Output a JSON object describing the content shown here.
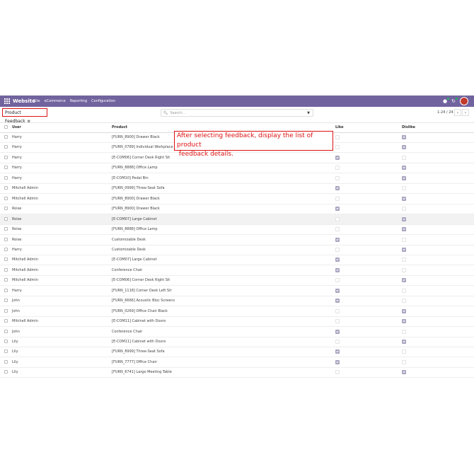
{
  "navbar": {
    "brand": "Website",
    "menu": [
      "Site",
      "eCommerce",
      "Reporting",
      "Configuration"
    ]
  },
  "control_panel": {
    "breadcrumb": "Product Feedback",
    "search_placeholder": "Search...",
    "pager": "1-24 / 24"
  },
  "table": {
    "headers": {
      "user": "User",
      "product": "Product",
      "like": "Like",
      "dislike": "Dislike"
    },
    "rows": [
      {
        "user": "Harry",
        "product": "[FURN_8900] Drawer Black",
        "like": false,
        "dislike": true
      },
      {
        "user": "Harry",
        "product": "[FURN_0789] Individual Workplace",
        "like": false,
        "dislike": true
      },
      {
        "user": "Harry",
        "product": "[E-COM06] Corner Desk Right Sit",
        "like": true,
        "dislike": false
      },
      {
        "user": "Harry",
        "product": "[FURN_8888] Office Lamp",
        "like": false,
        "dislike": true
      },
      {
        "user": "Harry",
        "product": "[E-COM10] Pedal Bin",
        "like": false,
        "dislike": true
      },
      {
        "user": "Mitchell Admin",
        "product": "[FURN_0999] Three-Seat Sofa",
        "like": true,
        "dislike": false
      },
      {
        "user": "Mitchell Admin",
        "product": "[FURN_8900] Drawer Black",
        "like": false,
        "dislike": true
      },
      {
        "user": "Roise",
        "product": "[FURN_8900] Drawer Black",
        "like": true,
        "dislike": false
      },
      {
        "user": "Roise",
        "product": "[E-COM07] Large Cabinet",
        "like": false,
        "dislike": true,
        "highlight": true
      },
      {
        "user": "Roise",
        "product": "[FURN_8888] Office Lamp",
        "like": false,
        "dislike": true
      },
      {
        "user": "Roise",
        "product": "Customizable Desk",
        "like": true,
        "dislike": false
      },
      {
        "user": "Harry",
        "product": "Customizable Desk",
        "like": false,
        "dislike": true
      },
      {
        "user": "Mitchell Admin",
        "product": "[E-COM07] Large Cabinet",
        "like": true,
        "dislike": false
      },
      {
        "user": "Mitchell Admin",
        "product": "Conference Chair",
        "like": true,
        "dislike": false
      },
      {
        "user": "Mitchell Admin",
        "product": "[E-COM06] Corner Desk Right Sit",
        "like": false,
        "dislike": true
      },
      {
        "user": "Harry",
        "product": "[FURN_1118] Corner Desk Left Sit",
        "like": true,
        "dislike": false
      },
      {
        "user": "John",
        "product": "[FURN_6666] Acoustic Bloc Screens",
        "like": true,
        "dislike": false
      },
      {
        "user": "John",
        "product": "[FURN_0269] Office Chair Black",
        "like": false,
        "dislike": true
      },
      {
        "user": "Mitchell Admin",
        "product": "[E-COM11] Cabinet with Doors",
        "like": false,
        "dislike": true
      },
      {
        "user": "John",
        "product": "Conference Chair",
        "like": true,
        "dislike": false
      },
      {
        "user": "Lily",
        "product": "[E-COM11] Cabinet with Doors",
        "like": false,
        "dislike": true
      },
      {
        "user": "Lily",
        "product": "[FURN_8999] Three-Seat Sofa",
        "like": true,
        "dislike": false
      },
      {
        "user": "Lily",
        "product": "[FURN_7777] Office Chair",
        "like": true,
        "dislike": false
      },
      {
        "user": "Lily",
        "product": "[FURN_6741] Large Meeting Table",
        "like": false,
        "dislike": true
      }
    ]
  },
  "annotation": {
    "line1": "After selecting feedback, display the list of product",
    "line2": " feedback details."
  },
  "colors": {
    "navbar": "#71639e",
    "annotation": "#dd1111",
    "checked": "#a7a5c0"
  }
}
